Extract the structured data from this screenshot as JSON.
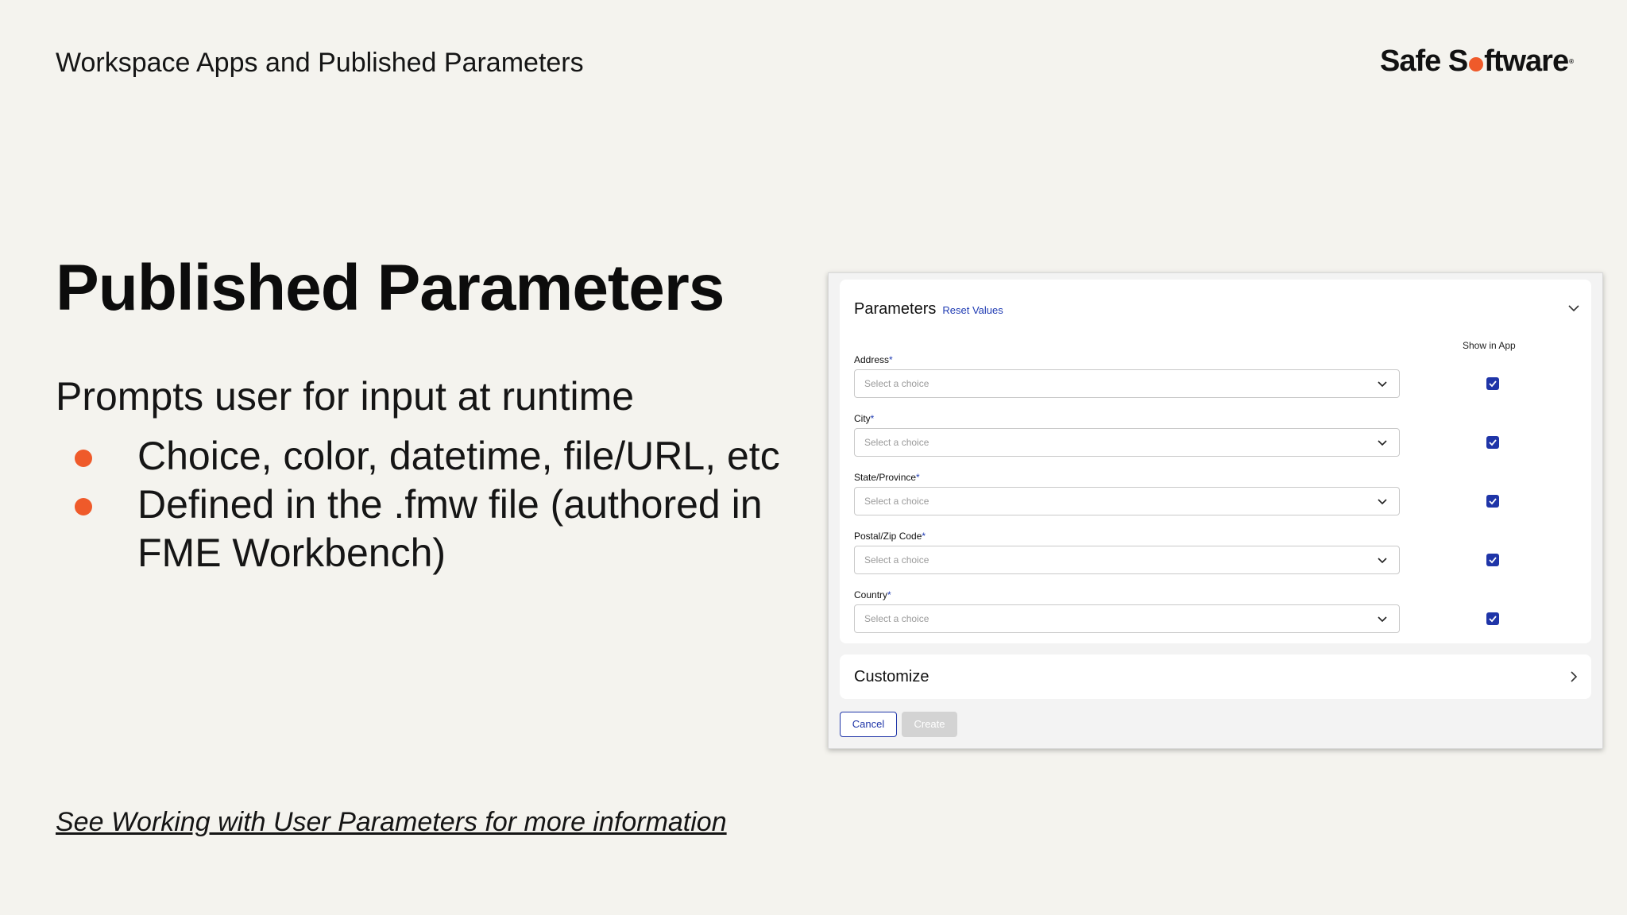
{
  "header": {
    "title": "Workspace Apps and Published Parameters"
  },
  "logo": {
    "text_before": "Safe S",
    "text_after": "ftware",
    "mark": "®",
    "accent_color": "#ef5a2a"
  },
  "slide": {
    "title": "Published Parameters",
    "lead": "Prompts user for input at runtime",
    "bullets": [
      "Choice, color, datetime, file/URL, etc",
      "Defined in the .fmw file (authored in FME Workbench)"
    ],
    "footer_link": "See Working with User Parameters for more information"
  },
  "panel": {
    "title": "Parameters",
    "reset_label": "Reset Values",
    "show_in_app_label": "Show in App",
    "required_mark": "*",
    "fields": [
      {
        "label": "Address",
        "placeholder": "Select a choice",
        "show_in_app": true
      },
      {
        "label": "City",
        "placeholder": "Select a choice",
        "show_in_app": true
      },
      {
        "label": "State/Province",
        "placeholder": "Select a choice",
        "show_in_app": true
      },
      {
        "label": "Postal/Zip Code",
        "placeholder": "Select a choice",
        "show_in_app": true
      },
      {
        "label": "Country",
        "placeholder": "Select a choice",
        "show_in_app": true
      }
    ],
    "customize_label": "Customize",
    "cancel_label": "Cancel",
    "create_label": "Create",
    "accent_color": "#1f35a8"
  }
}
